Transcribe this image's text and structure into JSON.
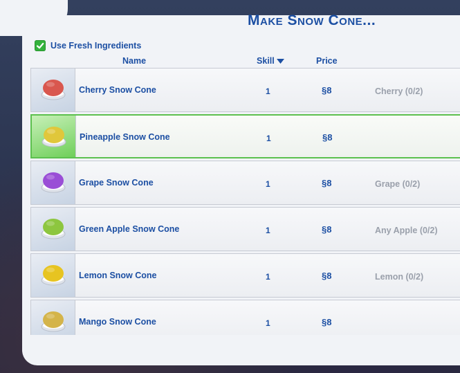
{
  "title": "Make Snow Cone...",
  "fresh_ingredients": {
    "label": "Use Fresh Ingredients",
    "checked": true
  },
  "columns": {
    "name": "Name",
    "skill": "Skill",
    "price": "Price"
  },
  "rows": [
    {
      "name": "Cherry Snow Cone",
      "skill": "1",
      "price": "§8",
      "ingredient": "Cherry (0/2)",
      "color": "#d9574e",
      "selected": false
    },
    {
      "name": "Pineapple Snow Cone",
      "skill": "1",
      "price": "§8",
      "ingredient": "",
      "color": "#e0c73b",
      "selected": true
    },
    {
      "name": "Grape Snow Cone",
      "skill": "1",
      "price": "§8",
      "ingredient": "Grape (0/2)",
      "color": "#9a4ed6",
      "selected": false
    },
    {
      "name": "Green Apple Snow Cone",
      "skill": "1",
      "price": "§8",
      "ingredient": "Any Apple (0/2)",
      "color": "#8dc63f",
      "selected": false
    },
    {
      "name": "Lemon Snow Cone",
      "skill": "1",
      "price": "§8",
      "ingredient": "Lemon (0/2)",
      "color": "#e7c421",
      "selected": false
    },
    {
      "name": "Mango Snow Cone",
      "skill": "1",
      "price": "§8",
      "ingredient": "",
      "color": "#d4b44a",
      "selected": false
    }
  ],
  "colors": {
    "accent": "#1c4fa3",
    "check": "#33b23c",
    "selected_border": "#5cc04e",
    "muted": "#9aa0ab"
  }
}
